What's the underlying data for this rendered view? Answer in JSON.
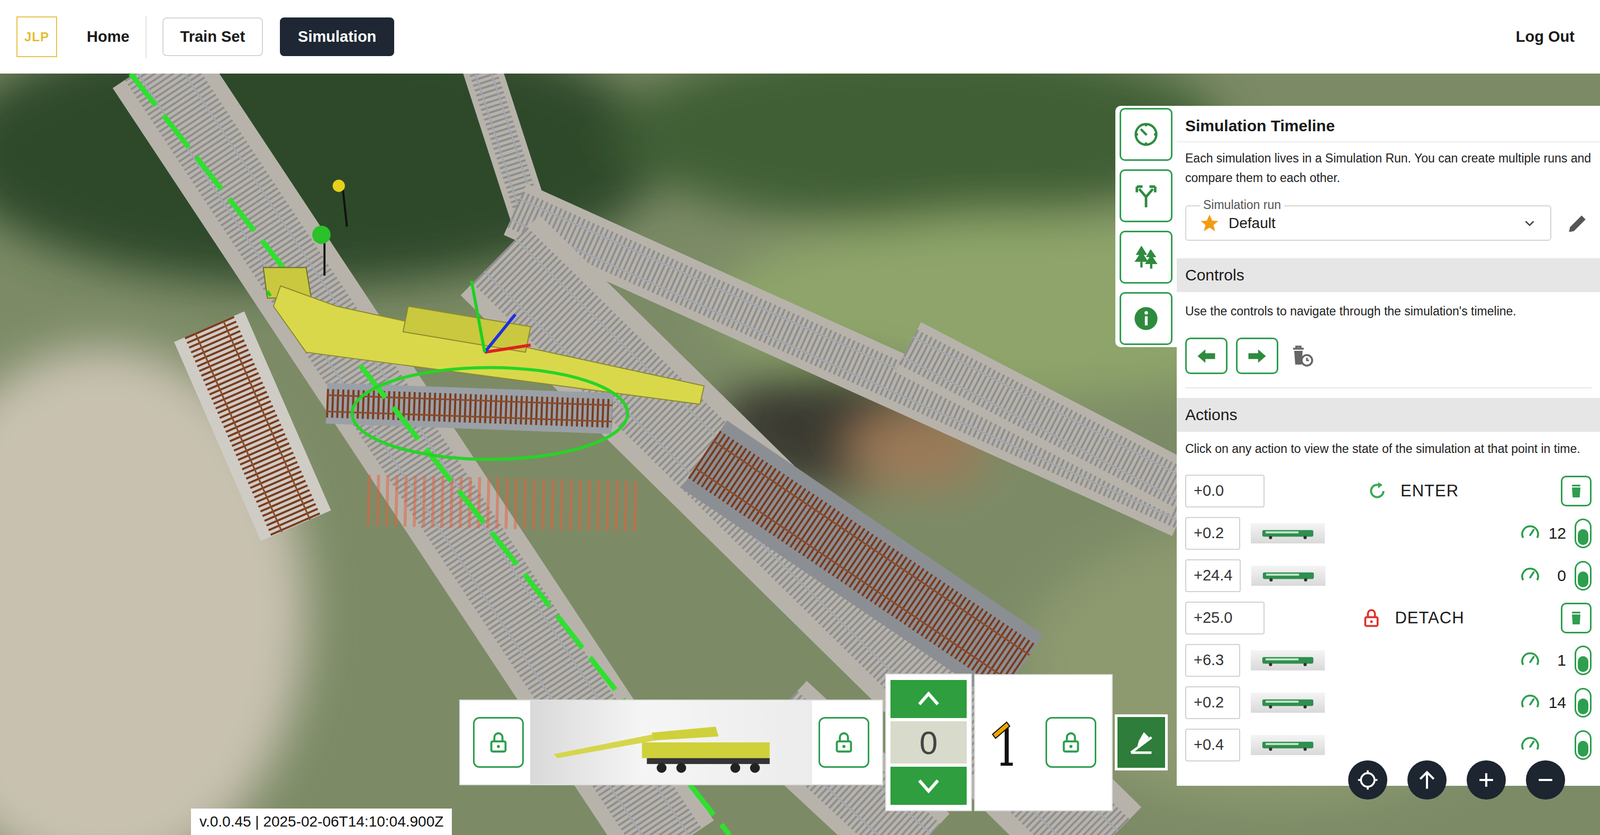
{
  "nav": {
    "logo": "JLP",
    "items": [
      {
        "label": "Home",
        "kind": "link",
        "selected": false
      },
      {
        "label": "Train Set",
        "kind": "button",
        "selected": false
      },
      {
        "label": "Simulation",
        "kind": "button",
        "selected": true
      }
    ],
    "logout": "Log Out"
  },
  "timeline": {
    "title": "Simulation Timeline",
    "description": "Each simulation lives in a Simulation Run. You can create multiple runs and compare them to each other.",
    "run_label": "Simulation run",
    "run_value": "Default"
  },
  "controls": {
    "title": "Controls",
    "description": "Use the controls to navigate through the simulation's timeline."
  },
  "actions": {
    "title": "Actions",
    "description": "Click on any action to view the state of the simulation at that point in time.",
    "rows": [
      {
        "time": "+0.0",
        "kind": "enter",
        "label": "ENTER",
        "color": "#3aa856"
      },
      {
        "time": "+0.2",
        "kind": "train",
        "speed": "12"
      },
      {
        "time": "+24.4",
        "kind": "train",
        "speed": "0"
      },
      {
        "time": "+25.0",
        "kind": "detach",
        "label": "DETACH",
        "color": "#e0302a"
      },
      {
        "time": "+6.3",
        "kind": "train",
        "speed": "1"
      },
      {
        "time": "+0.2",
        "kind": "train",
        "speed": "14"
      },
      {
        "time": "+0.4",
        "kind": "train"
      }
    ]
  },
  "car_counter": "0",
  "version": "v.0.0.45 | 2025-02-06T14:10:04.900Z"
}
